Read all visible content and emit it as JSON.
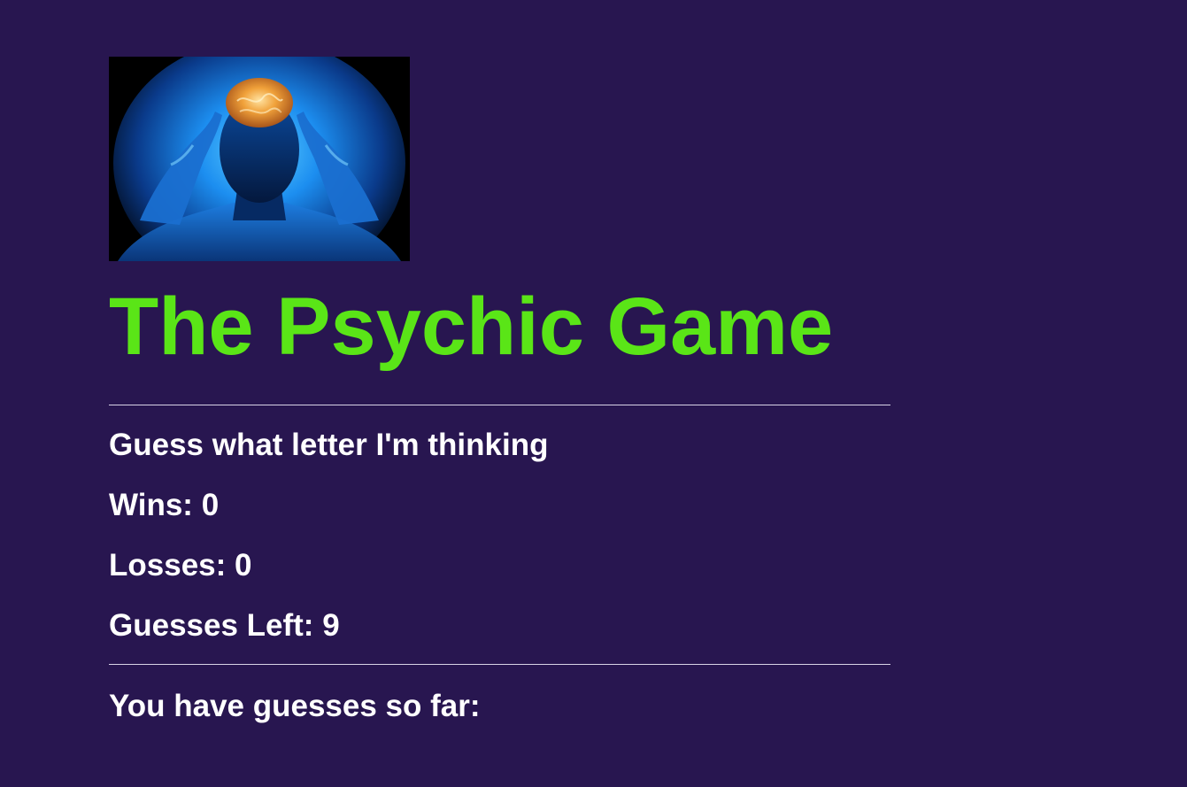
{
  "page": {
    "background": "#281650",
    "accent": "#5ae517"
  },
  "hero": {
    "image_subject": "glowing-brain-head-icon"
  },
  "game": {
    "title": "The Psychic Game",
    "prompt": "Guess what letter I'm thinking",
    "wins_label": "Wins: ",
    "wins": "0",
    "losses_label": "Losses: ",
    "losses": "0",
    "guesses_left_label": "Guesses Left: ",
    "guesses_left": "9",
    "guesses_so_far_label": "You have guesses so far:",
    "guesses_so_far": ""
  }
}
